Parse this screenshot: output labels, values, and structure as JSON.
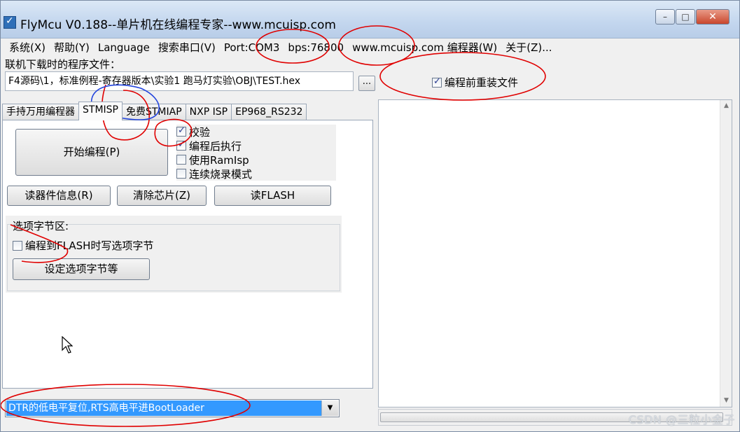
{
  "window": {
    "title": "FlyMcu V0.188--单片机在线编程专家--www.mcuisp.com"
  },
  "window_controls": {
    "minimize": "–",
    "maximize": "□",
    "close": "✕"
  },
  "menu": [
    {
      "label": "系统(X)"
    },
    {
      "label": "帮助(Y)"
    },
    {
      "label": "Language"
    },
    {
      "label": "搜索串口(V)"
    },
    {
      "label": "Port:COM3"
    },
    {
      "label": "bps:76800"
    },
    {
      "label": "www.mcuisp.com 编程器(W)"
    },
    {
      "label": "关于(Z)..."
    }
  ],
  "file": {
    "label": "联机下载时的程序文件：",
    "path": "F4源码\\1，标准例程-寄存器版本\\实验1 跑马灯实验\\OBJ\\TEST.hex",
    "browse_label": "...",
    "reload_label": "编程前重装文件",
    "reload_checked": true
  },
  "tabs": [
    {
      "label": "手持万用编程器",
      "active": false
    },
    {
      "label": "STMISP",
      "active": true
    },
    {
      "label": "免费STMIAP",
      "active": false
    },
    {
      "label": "NXP ISP",
      "active": false
    },
    {
      "label": "EP968_RS232",
      "active": false
    }
  ],
  "stmisp": {
    "start_button": "开始编程(P)",
    "options": [
      {
        "label": "校验",
        "checked": true
      },
      {
        "label": "编程后执行",
        "checked": true
      },
      {
        "label": "使用RamIsp",
        "checked": false
      },
      {
        "label": "连续烧录模式",
        "checked": false
      }
    ],
    "read_info_button": "读器件信息(R)",
    "erase_button": "清除芯片(Z)",
    "read_flash_button": "读FLASH",
    "option_bytes": {
      "title": "选项字节区:",
      "write_label": "编程到FLASH时写选项字节",
      "write_checked": false,
      "set_button": "设定选项字节等"
    }
  },
  "bootloader_mode": {
    "selected": "DTR的低电平复位,RTS高电平进BootLoader"
  },
  "watermark": "CSDN @三粒小金子",
  "colors": {
    "annotation": "#e00000",
    "annotation_blue": "#2244dd",
    "selection": "#3399ff"
  }
}
